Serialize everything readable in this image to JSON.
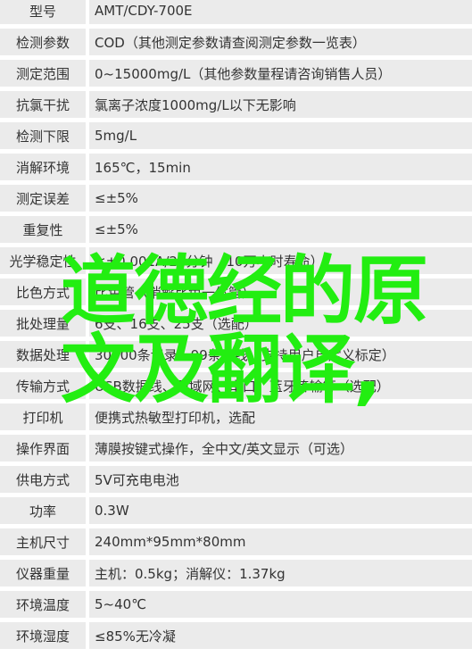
{
  "overlay": {
    "line1": "道德经的原",
    "line2": "文及翻译,",
    "color": "#22ee11"
  },
  "specs": [
    {
      "label": "型号",
      "value": "AMT/CDY-700E"
    },
    {
      "label": "检测参数",
      "value": "COD（其他测定参数请查阅测定参数一览表）"
    },
    {
      "label": "测定范围",
      "value": "0~15000mg/L（其他参数量程请咨询销售人员）"
    },
    {
      "label": "抗氯干扰",
      "value": "氯离子浓度1000mg/L以下无影响"
    },
    {
      "label": "检测下限",
      "value": "5mg/L"
    },
    {
      "label": "消解环境",
      "value": "165℃，15min"
    },
    {
      "label": "测定误差",
      "value": "≤±5%"
    },
    {
      "label": "重复性",
      "value": "≤±5%"
    },
    {
      "label": "光学稳定性",
      "value": "≤±0.001A/20分钟（10万小时寿命）"
    },
    {
      "label": "比色方式",
      "value": "比色管（消解比色一体管）"
    },
    {
      "label": "批处理量",
      "value": "6支、16支、25支（选配）"
    },
    {
      "label": "数据处理",
      "value": "30000条记录、99条曲线（支持用户自定义标定）"
    },
    {
      "label": "传输方式",
      "value": "USB数据线、局域网、串口、蓝牙传输等（选配）"
    },
    {
      "label": "打印机",
      "value": "便携式热敏型打印机，选配"
    },
    {
      "label": "操作界面",
      "value": "薄膜按键式操作，全中文/英文显示（可选）"
    },
    {
      "label": "供电方式",
      "value": "5V可充电电池"
    },
    {
      "label": "功率",
      "value": "0.3W"
    },
    {
      "label": "主机尺寸",
      "value": "240mm*95mm*80mm"
    },
    {
      "label": "仪器重量",
      "value": "主机：0.5kg；消解仪：1.37kg"
    },
    {
      "label": "环境温度",
      "value": "5~40℃"
    },
    {
      "label": "环境湿度",
      "value": "≤85%无冷凝"
    }
  ]
}
